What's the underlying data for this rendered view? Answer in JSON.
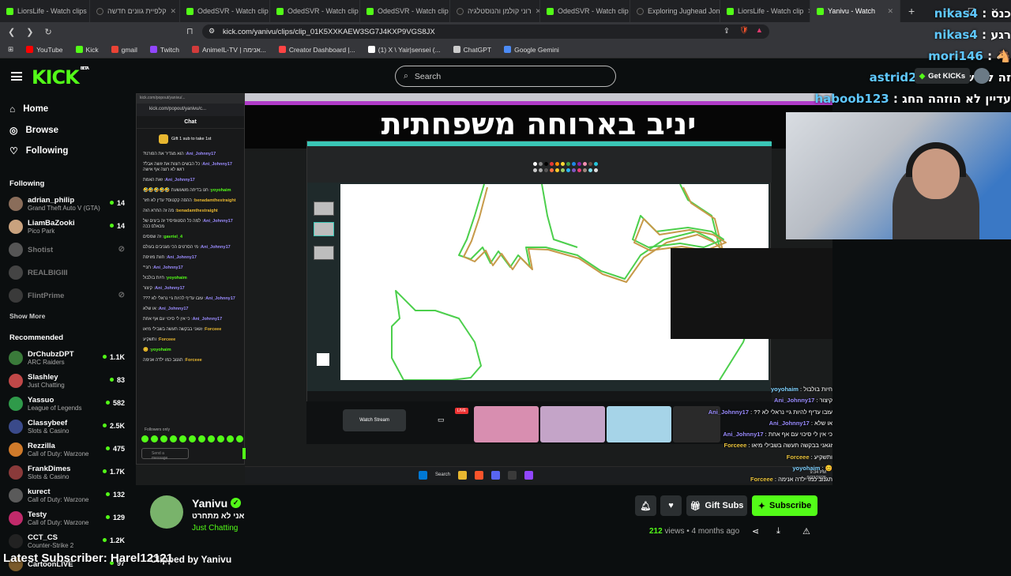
{
  "browser": {
    "tabs": [
      {
        "label": "LiorsLife - Watch clips",
        "icon": "kick-icon"
      },
      {
        "label": "קלפיית גוונים חדשה",
        "icon": "tiktok-icon"
      },
      {
        "label": "OdedSVR - Watch clip",
        "icon": "kick-icon"
      },
      {
        "label": "OdedSVR - Watch clip",
        "icon": "kick-icon"
      },
      {
        "label": "OdedSVR - Watch clip",
        "icon": "kick-icon"
      },
      {
        "label": "רוני קולמן והנוסטלגיה",
        "icon": "tiktok-icon"
      },
      {
        "label": "OdedSVR - Watch clip",
        "icon": "kick-icon"
      },
      {
        "label": "Exploring Jughead Jon",
        "icon": "tiktok-icon"
      },
      {
        "label": "LiorsLife - Watch clip",
        "icon": "kick-icon"
      },
      {
        "label": "Yanivu - Watch",
        "icon": "kick-icon"
      }
    ],
    "new_tab": "+",
    "url": "kick.com/yanivu/clips/clip_01K5XXKAEW3SG7J4KXP9VGS8JX",
    "bookmarks": [
      {
        "label": "YouTube",
        "color": "#ff0000"
      },
      {
        "label": "Kick",
        "color": "#53fc18"
      },
      {
        "label": "gmail",
        "color": "#ea4335"
      },
      {
        "label": "Twitch",
        "color": "#9146ff"
      },
      {
        "label": "AnimeIL-TV | אנימה...",
        "color": "#d23b3b"
      },
      {
        "label": "Creator Dashboard |...",
        "color": "#ff4444"
      },
      {
        "label": "(1) X \\ Yair|sensei (...",
        "color": "#ffffff"
      },
      {
        "label": "ChatGPT",
        "color": "#cccccc"
      },
      {
        "label": "Google Gemini",
        "color": "#4c8bf5"
      }
    ]
  },
  "kick": {
    "logo": "KICK",
    "logo_badge": "BETA",
    "search_placeholder": "Search",
    "get_kicks": "Get KICKs",
    "nav": [
      {
        "label": "Home",
        "icon": "home-icon"
      },
      {
        "label": "Browse",
        "icon": "compass-icon"
      },
      {
        "label": "Following",
        "icon": "heart-icon"
      }
    ],
    "following_title": "Following",
    "following": [
      {
        "name": "adrian_philip",
        "category": "Grand Theft Auto V (GTA)",
        "viewers": "14",
        "online": true,
        "color": "#8a6d5a"
      },
      {
        "name": "LiamBaZooki",
        "category": "Pico Park",
        "viewers": "14",
        "online": true,
        "color": "#c9a27e"
      },
      {
        "name": "Shotist",
        "category": "",
        "viewers": "⊘",
        "online": false,
        "color": "#555555"
      },
      {
        "name": "REALBIGIII",
        "category": "",
        "viewers": "",
        "online": false,
        "color": "#444444"
      },
      {
        "name": "FlintPrime",
        "category": "",
        "viewers": "⊘",
        "online": false,
        "color": "#3a3a3a"
      }
    ],
    "show_more": "Show More",
    "recommended_title": "Recommended",
    "recommended": [
      {
        "name": "DrChubzDPT",
        "category": "ARC Raiders",
        "viewers": "1.1K",
        "color": "#3a7a3a"
      },
      {
        "name": "Slashley",
        "category": "Just Chatting",
        "viewers": "83",
        "color": "#c04848"
      },
      {
        "name": "Yassuo",
        "category": "League of Legends",
        "viewers": "582",
        "color": "#2f9a4a"
      },
      {
        "name": "Classybeef",
        "category": "Slots & Casino",
        "viewers": "2.5K",
        "color": "#3a4a8a"
      },
      {
        "name": "Rezzilla",
        "category": "Call of Duty: Warzone",
        "viewers": "475",
        "color": "#d07a2a"
      },
      {
        "name": "FrankDimes",
        "category": "Slots & Casino",
        "viewers": "1.7K",
        "color": "#8a3a3a"
      },
      {
        "name": "kurect",
        "category": "Call of Duty: Warzone",
        "viewers": "132",
        "color": "#5a5a5a"
      },
      {
        "name": "Testy",
        "category": "Call of Duty: Warzone",
        "viewers": "129",
        "color": "#c02a6a"
      },
      {
        "name": "CCT_CS",
        "category": "Counter-Strike 2",
        "viewers": "1.2K",
        "color": "#222222"
      },
      {
        "name": "CartoonLIVE",
        "category": "",
        "viewers": "97",
        "color": "#7a5a2a"
      }
    ]
  },
  "video": {
    "stream_title_overlay": "יניב בארוחה משפחתית",
    "popout_chat": {
      "head": "kick.com/popout/yanivu/...",
      "url": "kick.com/popout/yanivu/c...",
      "title": "Chat",
      "gift": "Gift 1 sub to take 1st",
      "messages": [
        {
          "user": "Ani_Johnny17",
          "text": "הוא מגדיר את הפורנו?",
          "c": ""
        },
        {
          "user": "Ani_Johnny17",
          "text": "כל הבשים רוצות את זושה אבל? רושו לא רוצה אף אישה",
          "c": ""
        },
        {
          "user": "Ani_Johnny17",
          "text": "זאת האמת",
          "c": ""
        },
        {
          "user": "yoyohaim",
          "text": "חנו בדיחה משעשעת 🤣🤣🤣🤣🤣",
          "c": "y"
        },
        {
          "user": "benadamthestraight",
          "text": "ההפה קקטוס? עדין לא חזר",
          "c": "o"
        },
        {
          "user": "benadamthestraight",
          "text": "מה זה החרא הזה",
          "c": "o"
        },
        {
          "user": "Ani_Johnny17",
          "text": "למה כל הסטופיסיד זה ביצים של מכאלס ככה",
          "c": ""
        },
        {
          "user": "gavriel_4",
          "text": "זה שמסים",
          "c": "y"
        },
        {
          "user": "Ani_Johnny17",
          "text": "מי הסרטים הכי מגניבים בעולם",
          "c": ""
        },
        {
          "user": "Ani_Johnny17",
          "text": "חוות מזויפת",
          "c": ""
        },
        {
          "user": "Ani_Johnny17",
          "text": "רוני*",
          "c": ""
        },
        {
          "user": "yoyohaim",
          "text": "חיות בולבול",
          "c": "y"
        },
        {
          "user": "Ani_Johnny17",
          "text": "קיצור",
          "c": ""
        },
        {
          "user": "Ani_Johnny17",
          "text": "עזבו עדיף להיות גיי נראלי לא ???",
          "c": ""
        },
        {
          "user": "Ani_Johnny17",
          "text": "או שלא",
          "c": ""
        },
        {
          "user": "Ani_Johnny17",
          "text": "כי אין לי סיכוי עם אף אחת",
          "c": ""
        },
        {
          "user": "Forceee",
          "text": "זגאני בבקשה תעשה בשבילי מיאו",
          "c": "o"
        },
        {
          "user": "Forceee",
          "text": "ותשקיע",
          "c": "o"
        },
        {
          "user": "yoyohaim",
          "text": "😊",
          "c": "y"
        },
        {
          "user": "Forceee",
          "text": "תגנוב כמו ילדה אנימה",
          "c": "o"
        }
      ],
      "followers_only": "Followers only",
      "input_placeholder": "Send a message"
    },
    "watch_stream": "Watch Stream",
    "live": "LIVE",
    "overlay_chat": [
      {
        "user": "yoyohaim",
        "text": "חיות בולבול",
        "c": "b"
      },
      {
        "user": "Ani_Johnny17",
        "text": "קיצור",
        "c": "gr"
      },
      {
        "user": "Ani_Johnny17",
        "text": "עזבו עדיף להיות גיי נראלי לא ??",
        "c": "gr"
      },
      {
        "user": "Ani_Johnny17",
        "text": "או שלא",
        "c": "gr"
      },
      {
        "user": "Ani_Johnny17",
        "text": "כי אין לי סיכוי עם אף אחת",
        "c": "gr"
      },
      {
        "user": "Forceee",
        "text": "זגאני בבקשה תעשה בשבילי מיאו",
        "c": "yl"
      },
      {
        "user": "Forceee",
        "text": "ותשקיע",
        "c": "yl"
      },
      {
        "user": "yoyohaim",
        "text": "😊",
        "c": "b"
      },
      {
        "user": "Forceee",
        "text": "תגנוב כמו ילדה אנימה",
        "c": "yl"
      }
    ],
    "clock": "9:34 PM",
    "date": "9/23/2025",
    "win_search": "Search"
  },
  "overlay_top_chat": [
    {
      "user": "nikas4",
      "text": "כנס"
    },
    {
      "user": "nikas4",
      "text": "רגע"
    },
    {
      "user": "mori146",
      "text": "🐴"
    },
    {
      "user": "astrid2147",
      "text": "זה לא שלי"
    },
    {
      "user": "haboob123",
      "text": "עדיין לא הוזהה החג"
    }
  ],
  "clip": {
    "streamer": "Yanivu",
    "title": "אני לא מתחרט",
    "category": "Just Chatting",
    "gift_subs": "Gift Subs",
    "subscribe": "Subscribe",
    "views": "212",
    "views_label": "views",
    "ago": "4 months ago",
    "clipped_by": "Yanivu",
    "clipped_prefix": "Clipped by",
    "latest_sub": "Latest Subscriber: Harel12121"
  }
}
